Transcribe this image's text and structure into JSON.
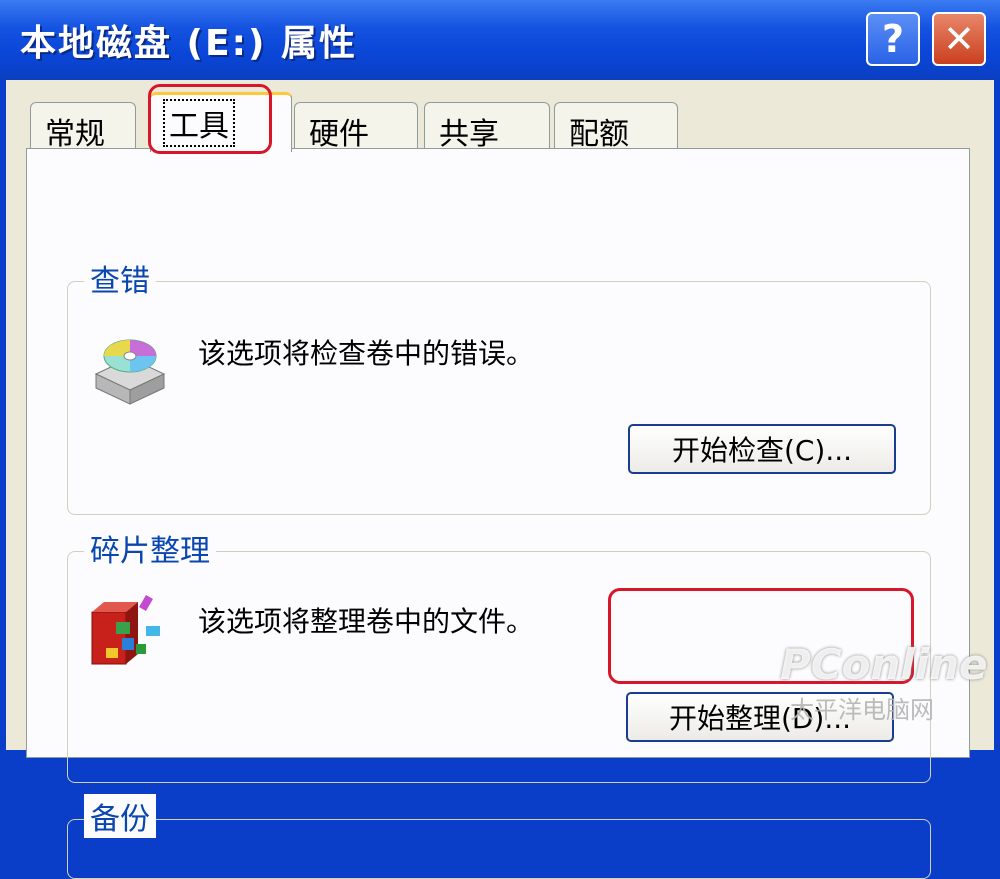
{
  "window": {
    "title": "本地磁盘 (E:) 属性",
    "help_glyph": "?",
    "close_glyph": "✕"
  },
  "tabs": [
    {
      "label": "常规"
    },
    {
      "label": "工具",
      "active": true
    },
    {
      "label": "硬件"
    },
    {
      "label": "共享"
    },
    {
      "label": "配额"
    }
  ],
  "error_check": {
    "title": "查错",
    "description": "该选项将检查卷中的错误。",
    "button_label": "开始检查(C)...",
    "icon": "disk-check-icon"
  },
  "defrag": {
    "title": "碎片整理",
    "description": "该选项将整理卷中的文件。",
    "button_label": "开始整理(D)...",
    "icon": "defragment-icon"
  },
  "backup": {
    "title": "备份"
  },
  "watermark": {
    "brand": "PConline",
    "sub": "太平洋电脑网"
  },
  "colors": {
    "titlebar": "#0a45d6",
    "window_bg": "#ece9d8",
    "group_title": "#0a46b0",
    "annotation": "#d7162a",
    "active_tab_accent": "#ffc83c"
  }
}
